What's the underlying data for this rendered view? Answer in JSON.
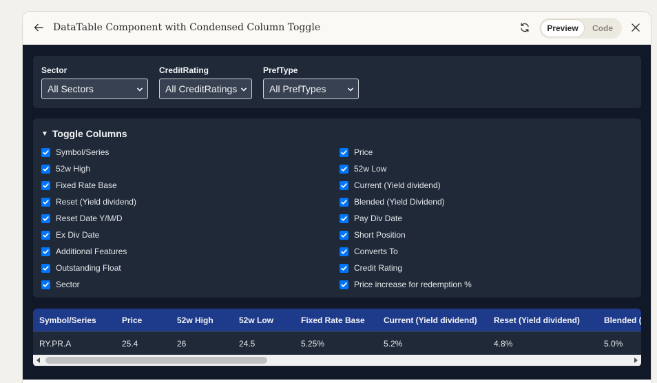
{
  "window": {
    "title": "DataTable Component with Condensed Column Toggle",
    "preview_label": "Preview",
    "code_label": "Code",
    "icons": [
      "arrow-left-icon",
      "refresh-icon",
      "close-icon"
    ]
  },
  "filters": [
    {
      "label": "Sector",
      "selected": "All Sectors"
    },
    {
      "label": "CreditRating",
      "selected": "All CreditRatings"
    },
    {
      "label": "PrefType",
      "selected": "All PrefTypes"
    }
  ],
  "toggle": {
    "heading": "Toggle Columns",
    "expanded": true,
    "options": [
      {
        "label": "Symbol/Series",
        "checked": true
      },
      {
        "label": "Price",
        "checked": true
      },
      {
        "label": "52w High",
        "checked": true
      },
      {
        "label": "52w Low",
        "checked": true
      },
      {
        "label": "Fixed Rate Base",
        "checked": true
      },
      {
        "label": "Current (Yield dividend)",
        "checked": true
      },
      {
        "label": "Reset (Yield dividend)",
        "checked": true
      },
      {
        "label": "Blended (Yield Dividend)",
        "checked": true
      },
      {
        "label": "Reset Date Y/M/D",
        "checked": true
      },
      {
        "label": "Pay Div Date",
        "checked": true
      },
      {
        "label": "Ex Div Date",
        "checked": true
      },
      {
        "label": "Short Position",
        "checked": true
      },
      {
        "label": "Additional Features",
        "checked": true
      },
      {
        "label": "Converts To",
        "checked": true
      },
      {
        "label": "Outstanding Float",
        "checked": true
      },
      {
        "label": "Credit Rating",
        "checked": true
      },
      {
        "label": "Sector",
        "checked": true
      },
      {
        "label": "Price increase for redemption %",
        "checked": true
      }
    ]
  },
  "table": {
    "headers": [
      "Symbol/Series",
      "Price",
      "52w High",
      "52w Low",
      "Fixed Rate Base",
      "Current (Yield dividend)",
      "Reset (Yield dividend)",
      "Blended ("
    ],
    "rows": [
      [
        "RY.PR.A",
        "25.4",
        "26",
        "24.5",
        "5.25%",
        "5.2%",
        "4.8%",
        "5.0%"
      ]
    ]
  },
  "colors": {
    "panel": "#1f2937",
    "background": "#111827",
    "header": "#1e3a8a",
    "checkbox": "#0075ff"
  }
}
